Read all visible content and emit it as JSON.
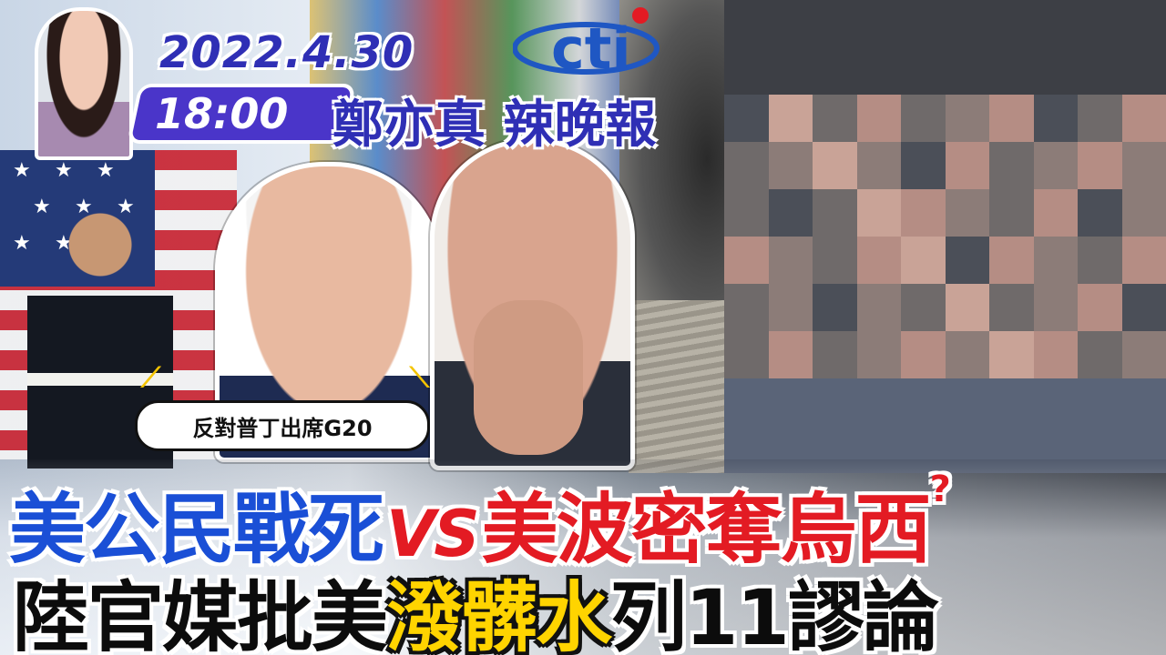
{
  "header": {
    "date": "2022.4.30",
    "time": "18:00",
    "show_title": "鄭亦真 辣晚報",
    "logo_text": "cti"
  },
  "callout": {
    "text": "反對普丁出席G20"
  },
  "headline": {
    "line1_part1": "美公民戰死",
    "vs": "VS",
    "line1_part2": "美波密奪烏西",
    "question_mark": "?",
    "line2_part1": "陸官媒批美",
    "line2_highlight": "潑髒水",
    "line2_part2": "列11謬論"
  },
  "colors": {
    "date_blue": "#2f2fb5",
    "time_box_purple": "#4a35c9",
    "headline_blue": "#1a4fd6",
    "headline_red": "#e31b23",
    "headline_yellow": "#ffd400",
    "logo_blue": "#1f57c3"
  }
}
